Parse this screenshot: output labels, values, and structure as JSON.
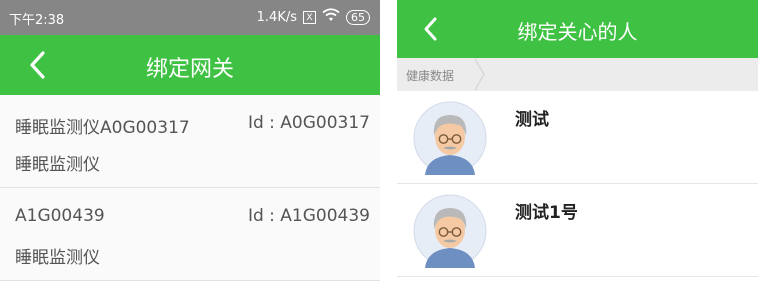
{
  "status_bar": {
    "time": "下午2:38",
    "speed": "1.4K/s",
    "sim_glyph": "X",
    "battery": "65"
  },
  "left": {
    "title": "绑定网关",
    "devices": [
      {
        "name": "睡眠监测仪A0G00317",
        "id": "Id : A0G00317",
        "type": "睡眠监测仪"
      },
      {
        "name": "A1G00439",
        "id": "Id : A1G00439",
        "type": "睡眠监测仪"
      }
    ]
  },
  "right": {
    "title": "绑定关心的人",
    "breadcrumb": "健康数据",
    "people": [
      {
        "name": "测试"
      },
      {
        "name": "测试1号"
      }
    ]
  },
  "colors": {
    "accent_green": "#3fc243",
    "status_gray": "#868686"
  },
  "icons": {
    "back": "chevron-left-icon",
    "wifi": "wifi-icon",
    "sim": "no-sim-icon",
    "battery": "battery-icon",
    "avatar": "elderly-man-avatar-icon",
    "breadcrumb_separator": "chevron-right-icon"
  }
}
